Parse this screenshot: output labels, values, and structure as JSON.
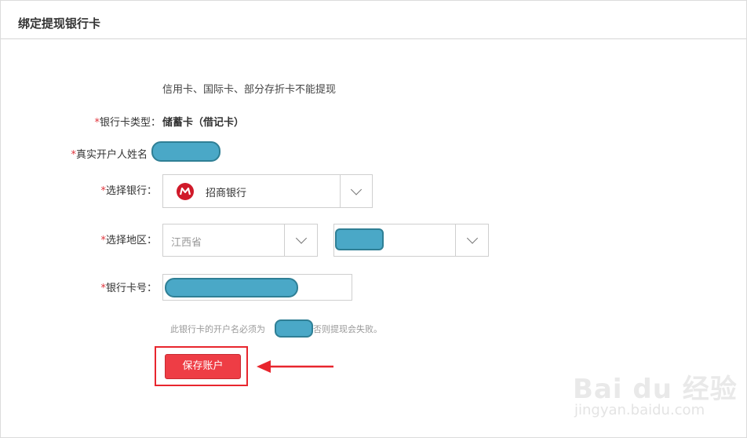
{
  "header": {
    "title": "绑定提现银行卡"
  },
  "notice": "信用卡、国际卡、部分存折卡不能提现",
  "card_type": {
    "required_mark": "*",
    "label": "银行卡类型：",
    "value": "储蓄卡（借记卡）"
  },
  "holder_name": {
    "required_mark": "*",
    "label": "真实开户人姓名"
  },
  "bank": {
    "required_mark": "*",
    "label": "选择银行：",
    "selected": "招商银行",
    "logo_icon": "cmb-bank-logo-icon"
  },
  "region": {
    "required_mark": "*",
    "label": "选择地区：",
    "province": "江西省"
  },
  "card_number": {
    "required_mark": "*",
    "label": "银行卡号："
  },
  "hint": {
    "before": "此银行卡的开户名必须为",
    "after": "，否则提现会失败。"
  },
  "save_button": {
    "label": "保存账户"
  },
  "watermark": {
    "logo": "Bai du 经验",
    "url": "jingyan.baidu.com"
  },
  "colors": {
    "accent": "#ee3d45",
    "required": "#e0343c",
    "highlight": "#e8262e",
    "redaction": "#4aa8c7"
  }
}
